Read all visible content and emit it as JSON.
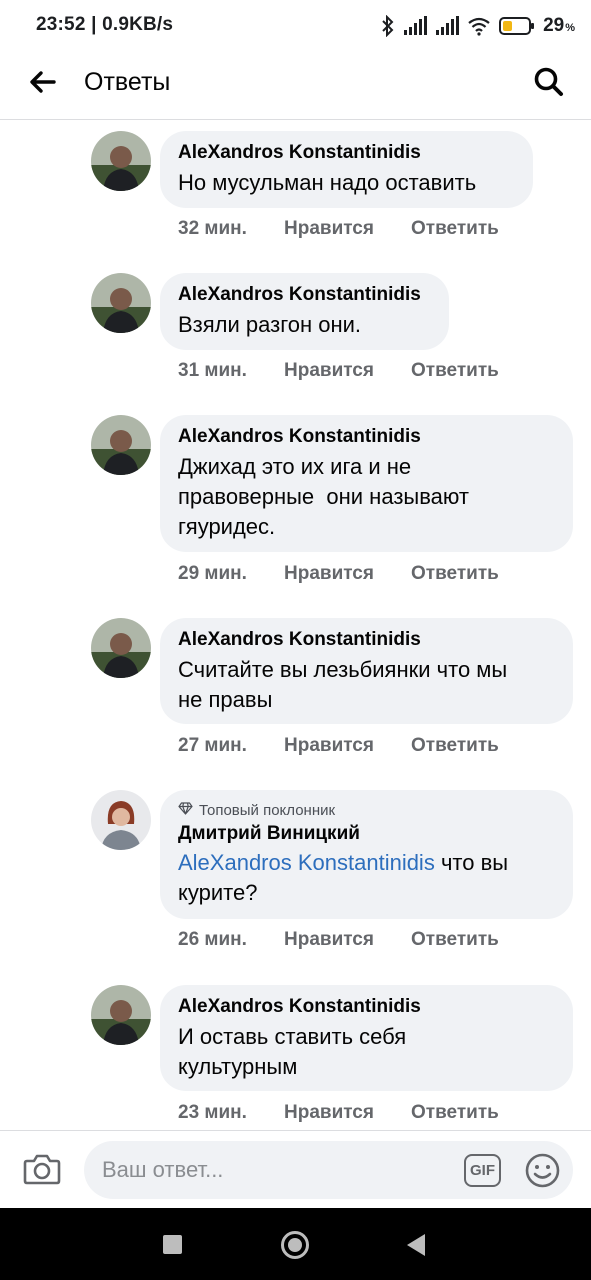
{
  "status_bar": {
    "time_speed": "23:52 | 0.9KB/s",
    "battery": "29",
    "battery_unit": "%",
    "icons": [
      "bluetooth-icon",
      "signal-icon",
      "signal-icon",
      "wifi-icon",
      "battery-icon"
    ]
  },
  "header": {
    "title": "Ответы",
    "back_icon": "arrow-left-icon",
    "search_icon": "search-icon"
  },
  "comments": [
    {
      "author": "AleXandros Konstantinidis",
      "text": "Но мусульман надо оставить",
      "time": "32 мин.",
      "like": "Нравится",
      "reply": "Ответить"
    },
    {
      "author": "AleXandros Konstantinidis",
      "text": "Взяли разгон они.",
      "time": "31 мин.",
      "like": "Нравится",
      "reply": "Ответить"
    },
    {
      "author": "AleXandros Konstantinidis",
      "text_lines": [
        "Джихад это их ига и не",
        "правоверные  они называют",
        "гяуридес."
      ],
      "time": "29 мин.",
      "like": "Нравится",
      "reply": "Ответить"
    },
    {
      "author": "AleXandros Konstantinidis",
      "text_lines": [
        "Считайте вы лезьбиянки что мы",
        "не правы"
      ],
      "time": "27 мин.",
      "like": "Нравится",
      "reply": "Ответить"
    },
    {
      "badge": "Топовый поклонник",
      "badge_icon": "diamond-icon",
      "author": "Дмитрий Виницкий",
      "mention": "AleXandros Konstantinidis",
      "text_after_mention": " что вы",
      "text_line2": "курите?",
      "time": "26 мин.",
      "like": "Нравится",
      "reply": "Ответить"
    },
    {
      "author": "AleXandros Konstantinidis",
      "text_lines": [
        "И оставь ставить себя",
        "культурным"
      ],
      "time": "23 мин.",
      "like": "Нравится",
      "reply": "Ответить"
    }
  ],
  "composer": {
    "placeholder": "Ваш ответ...",
    "gif_label": "GIF",
    "camera_icon": "camera-icon",
    "emoji_icon": "emoji-icon"
  },
  "colors": {
    "bubble": "#f0f2f5",
    "secondary_text": "#65676b",
    "mention": "#2d6ebd"
  }
}
